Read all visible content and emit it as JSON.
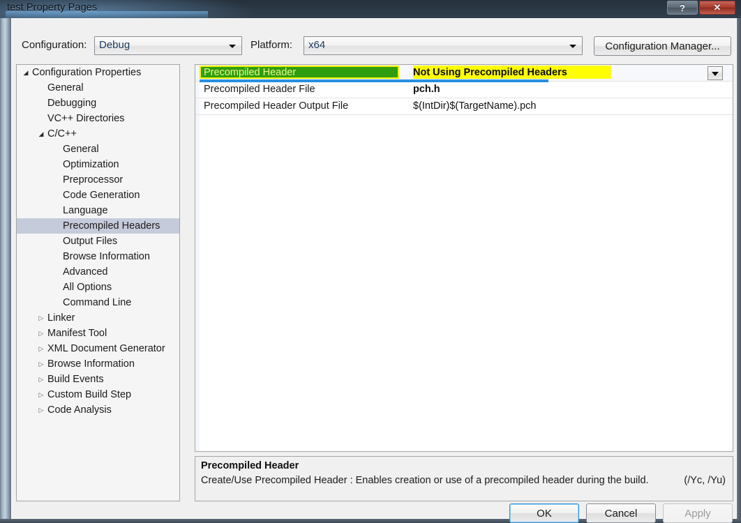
{
  "window": {
    "title": "test Property Pages",
    "help_button": "?",
    "close_button": "✕"
  },
  "config_bar": {
    "configuration_label": "Configuration:",
    "configuration_value": "Debug",
    "platform_label": "Platform:",
    "platform_value": "x64",
    "configuration_manager_button": "Configuration Manager..."
  },
  "tree": {
    "items": [
      {
        "label": "Configuration Properties",
        "depth": 0,
        "twisty": "expanded",
        "selected": false
      },
      {
        "label": "General",
        "depth": 1,
        "twisty": "none",
        "selected": false
      },
      {
        "label": "Debugging",
        "depth": 1,
        "twisty": "none",
        "selected": false
      },
      {
        "label": "VC++ Directories",
        "depth": 1,
        "twisty": "none",
        "selected": false
      },
      {
        "label": "C/C++",
        "depth": 1,
        "twisty": "expanded",
        "selected": false
      },
      {
        "label": "General",
        "depth": 2,
        "twisty": "none",
        "selected": false
      },
      {
        "label": "Optimization",
        "depth": 2,
        "twisty": "none",
        "selected": false
      },
      {
        "label": "Preprocessor",
        "depth": 2,
        "twisty": "none",
        "selected": false
      },
      {
        "label": "Code Generation",
        "depth": 2,
        "twisty": "none",
        "selected": false
      },
      {
        "label": "Language",
        "depth": 2,
        "twisty": "none",
        "selected": false
      },
      {
        "label": "Precompiled Headers",
        "depth": 2,
        "twisty": "none",
        "selected": true
      },
      {
        "label": "Output Files",
        "depth": 2,
        "twisty": "none",
        "selected": false
      },
      {
        "label": "Browse Information",
        "depth": 2,
        "twisty": "none",
        "selected": false
      },
      {
        "label": "Advanced",
        "depth": 2,
        "twisty": "none",
        "selected": false
      },
      {
        "label": "All Options",
        "depth": 2,
        "twisty": "none",
        "selected": false
      },
      {
        "label": "Command Line",
        "depth": 2,
        "twisty": "none",
        "selected": false
      },
      {
        "label": "Linker",
        "depth": 1,
        "twisty": "collapsed",
        "selected": false
      },
      {
        "label": "Manifest Tool",
        "depth": 1,
        "twisty": "collapsed",
        "selected": false
      },
      {
        "label": "XML Document Generator",
        "depth": 1,
        "twisty": "collapsed",
        "selected": false
      },
      {
        "label": "Browse Information",
        "depth": 1,
        "twisty": "collapsed",
        "selected": false
      },
      {
        "label": "Build Events",
        "depth": 1,
        "twisty": "collapsed",
        "selected": false
      },
      {
        "label": "Custom Build Step",
        "depth": 1,
        "twisty": "collapsed",
        "selected": false
      },
      {
        "label": "Code Analysis",
        "depth": 1,
        "twisty": "collapsed",
        "selected": false
      }
    ],
    "twisty_glyphs": {
      "expanded": "◢",
      "collapsed": "▷"
    }
  },
  "property_grid": {
    "rows": [
      {
        "name": "Precompiled Header",
        "value": "Not Using Precompiled Headers",
        "bold_value": true,
        "selected": true,
        "has_dropdown": true,
        "name_highlight": "#2f9e0e",
        "value_highlight": "#ffff00"
      },
      {
        "name": "Precompiled Header File",
        "value": "pch.h",
        "bold_value": true,
        "selected": false,
        "has_dropdown": false
      },
      {
        "name": "Precompiled Header Output File",
        "value": "$(IntDir)$(TargetName).pch",
        "bold_value": false,
        "selected": false,
        "has_dropdown": false
      }
    ],
    "dropdown_icon": "chevron-down-icon"
  },
  "description": {
    "title": "Precompiled Header",
    "body": "Create/Use Precompiled Header : Enables creation or use of a precompiled header during the build.",
    "switches": "(/Yc, /Yu)"
  },
  "buttons": {
    "ok": "OK",
    "cancel": "Cancel",
    "apply": "Apply"
  },
  "colors": {
    "highlight_green": "#2f9e0e",
    "highlight_yellow": "#ffff00",
    "selection_blue": "#2a8fe0",
    "tree_selection": "#c6cbdb",
    "close_red": "#a93b2d"
  }
}
